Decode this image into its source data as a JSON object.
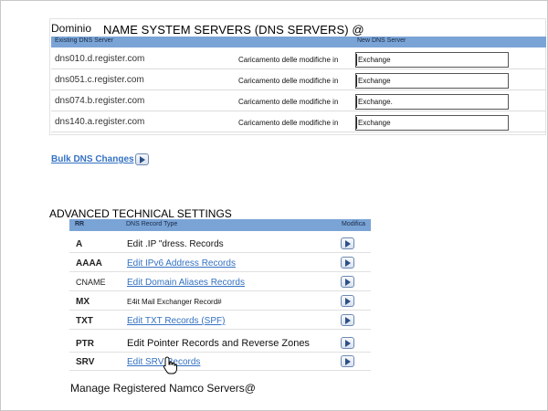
{
  "dns": {
    "domain_label": "Dominio",
    "title": "NAME SYSTEM SERVERS (DNS SERVERS) @",
    "header_existing": "Existing DNS Server",
    "header_new": "New DNS Server",
    "rows": [
      {
        "server": "dns010.d.register.com",
        "status": "Caricamento delle modifiche in",
        "new_value": "Exchange"
      },
      {
        "server": "dns051.c.register.com",
        "status": "Caricamento delle modifiche in",
        "new_value": "Exchange"
      },
      {
        "server": "dns074.b.register.com",
        "status": "Caricamento delle modifiche in",
        "new_value": "Exchange."
      },
      {
        "server": "dns140.a.register.com",
        "status": "Caricamento delle modifiche in",
        "new_value": "Exchange"
      }
    ],
    "bulk_link": "Bulk DNS Changes"
  },
  "advanced": {
    "title": "ADVANCED TECHNICAL SETTINGS",
    "header_rr": "RR",
    "header_type": "DNS Record Type",
    "header_modify": "Modifica",
    "records": [
      {
        "rr": "A",
        "label": "Edit .IP \"dress. Records"
      },
      {
        "rr": "AAAA",
        "label": "Edit IPv6 Address Records"
      },
      {
        "rr": "CNAME",
        "label": "Edit Domain Aliases Records"
      },
      {
        "rr": "MX",
        "label": "E4it Mail Exchanger Record#"
      },
      {
        "rr": "TXT",
        "label": "Edit TXT Records (SPF)"
      },
      {
        "rr": "PTR",
        "label": "Edit Pointer Records and Reverse Zones"
      },
      {
        "rr": "SRV",
        "label": "Edit SRV Records"
      }
    ]
  },
  "footer": "Manage Registered Namco Servers@",
  "colors": {
    "header_bg": "#7aa4d6",
    "link": "#3471c2"
  },
  "icons": {
    "arrow": "arrow-right-icon",
    "cursor": "hand-pointer-icon"
  }
}
